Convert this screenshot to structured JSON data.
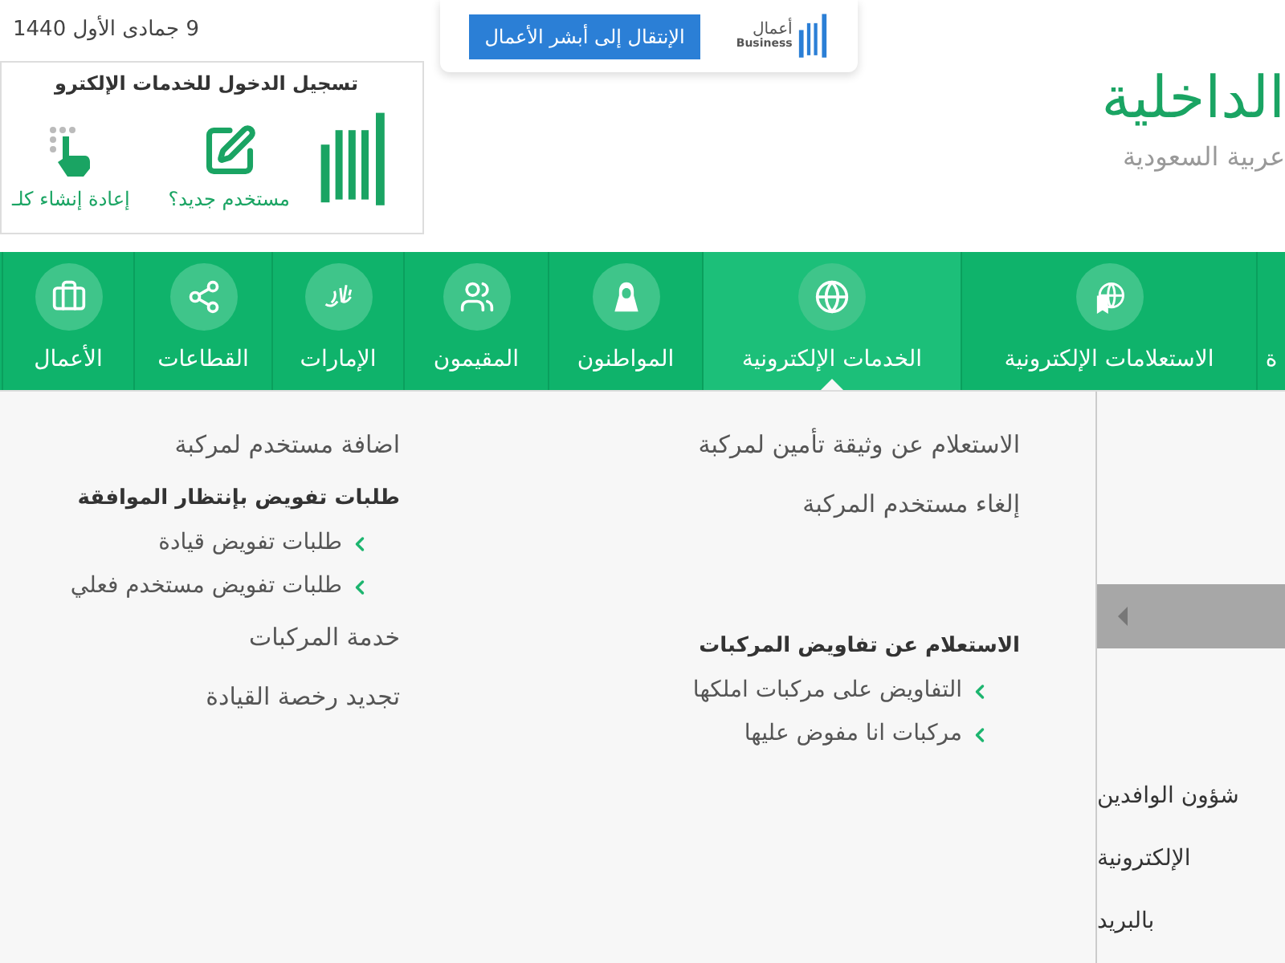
{
  "date": "9 جمادى الأول 1440",
  "business": {
    "logo_text": "أعمال",
    "logo_subtext": "Business",
    "button": "الإنتقال إلى أبشر الأعمال"
  },
  "ministry": {
    "name": "الداخلية",
    "subtitle": "عربية السعودية"
  },
  "login": {
    "title": "تسجيل الدخول للخدمات الإلكترو",
    "actions": [
      "مستخدم جديد؟",
      "إعادة إنشاء كلـ"
    ]
  },
  "nav": [
    {
      "label": "ة",
      "selected": false
    },
    {
      "label": "الاستعلامات الإلكترونية",
      "selected": false
    },
    {
      "label": "الخدمات الإلكترونية",
      "selected": true
    },
    {
      "label": "المواطنون",
      "selected": false
    },
    {
      "label": "المقيمون",
      "selected": false
    },
    {
      "label": "الإمارات",
      "selected": false
    },
    {
      "label": "القطاعات",
      "selected": false
    },
    {
      "label": "الأعمال",
      "selected": false
    }
  ],
  "menu": {
    "columns": [
      {
        "sections": [
          [
            {
              "kind": "link",
              "label": "الاستعلام عن وثيقة تأمين لمركبة"
            },
            {
              "kind": "link",
              "label": "إلغاء مستخدم المركبة"
            }
          ],
          [
            {
              "kind": "heading",
              "label": "الاستعلام عن تفاويض المركبات"
            },
            {
              "kind": "sublink",
              "label": "التفاويض على مركبات املكها"
            },
            {
              "kind": "sublink",
              "label": "مركبات انا مفوض عليها"
            }
          ]
        ]
      },
      {
        "sections": [
          [
            {
              "kind": "link",
              "label": "اضافة مستخدم لمركبة"
            },
            {
              "kind": "heading",
              "label": "طلبات تفويض بإنتظار الموافقة"
            },
            {
              "kind": "sublink",
              "label": "طلبات تفويض قيادة"
            },
            {
              "kind": "sublink",
              "label": "طلبات تفويض مستخدم فعلي"
            },
            {
              "kind": "link",
              "label": "خدمة المركبات"
            },
            {
              "kind": "link",
              "label": "تجديد رخصة القيادة"
            }
          ]
        ]
      }
    ]
  },
  "side_panel": {
    "items": [
      "شؤون الوافدين",
      "الإلكترونية",
      "بالبريد"
    ]
  }
}
